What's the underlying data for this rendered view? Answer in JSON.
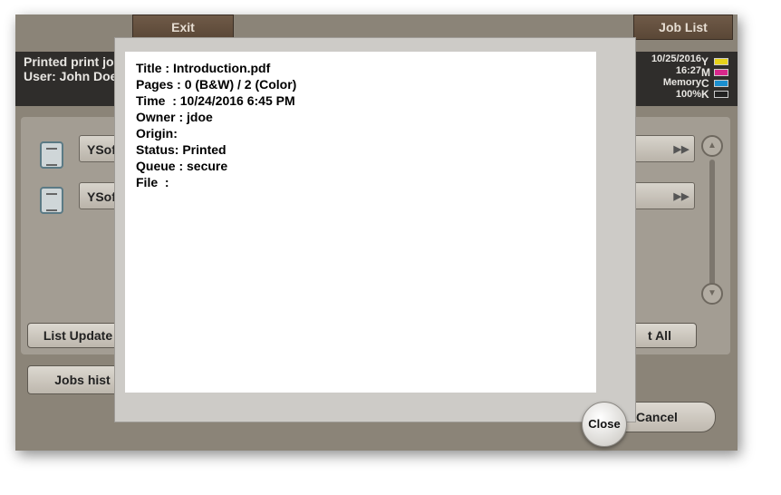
{
  "topbar": {
    "exit_label": "Exit",
    "joblist_label": "Job List"
  },
  "header": {
    "line1": "Printed print job",
    "line2": "User: John Doe"
  },
  "status": {
    "date": "10/25/2016",
    "time": "16:27",
    "memory_label": "Memory",
    "memory_value": "100%"
  },
  "toner": [
    {
      "letter": "Y",
      "color": "#e6d21a"
    },
    {
      "letter": "M",
      "color": "#d8288c"
    },
    {
      "letter": "C",
      "color": "#1b8fd0"
    },
    {
      "letter": "K",
      "color": "#222222"
    }
  ],
  "jobs": [
    {
      "label": "YSoft"
    },
    {
      "label": "YSoft"
    }
  ],
  "buttons": {
    "list_update": "List Update",
    "select_all": "t All",
    "jobs_history": "Jobs hist",
    "cancel": "Cancel",
    "close": "Close"
  },
  "dialog": {
    "lines": [
      "Title : Introduction.pdf",
      "Pages : 0 (B&W) / 2 (Color)",
      "Time  : 10/24/2016 6:45 PM",
      "Owner : jdoe",
      "Origin:",
      "Status: Printed",
      "Queue : secure",
      "File  :"
    ]
  }
}
